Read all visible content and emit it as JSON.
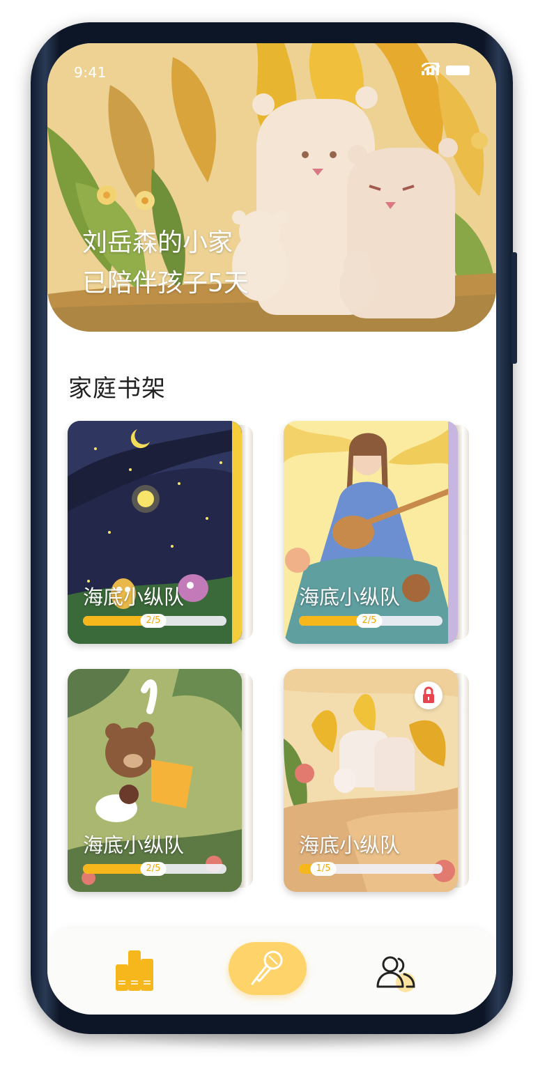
{
  "status_bar": {
    "time": "9:41"
  },
  "hero": {
    "line1": "刘岳森的小家",
    "line2": "已陪伴孩子5天"
  },
  "section": {
    "title": "家庭书架"
  },
  "books": [
    {
      "title": "海底小纵队",
      "progress_label": "2/5",
      "progress": 0.45,
      "locked": false
    },
    {
      "title": "海底小纵队",
      "progress_label": "2/5",
      "progress": 0.45,
      "locked": false
    },
    {
      "title": "海底小纵队",
      "progress_label": "2/5",
      "progress": 0.45,
      "locked": false
    },
    {
      "title": "海底小纵队",
      "progress_label": "1/5",
      "progress": 0.17,
      "locked": true
    }
  ],
  "tabbar": {
    "items": [
      {
        "icon": "bookshelf-icon",
        "active": true
      },
      {
        "icon": "microphone-icon",
        "active": false
      },
      {
        "icon": "users-icon",
        "active": false
      }
    ]
  },
  "colors": {
    "accent": "#f6b71d",
    "accent_light": "#fdd36a",
    "lock": "#e8464f",
    "text": "#222222"
  }
}
